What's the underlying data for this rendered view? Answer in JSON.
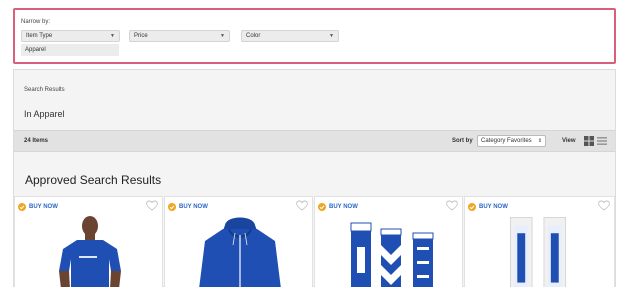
{
  "filters": {
    "narrow_label": "Narrow by:",
    "item_type": "Item Type",
    "price": "Price",
    "color": "Color",
    "selected": "Apparel"
  },
  "results": {
    "search_results_label": "Search Results",
    "in_category": "In Apparel",
    "items_count": "24 Items",
    "sort_by_label": "Sort by",
    "sort_value": "Category Favorites",
    "view_label": "View",
    "approved_title": "Approved Search Results"
  },
  "products": [
    {
      "badge": "BUY NOW",
      "icon": "tshirt-model-image"
    },
    {
      "badge": "BUY NOW",
      "icon": "hoodie-image"
    },
    {
      "badge": "BUY NOW",
      "icon": "socks-image"
    },
    {
      "badge": "BUY NOW",
      "icon": "packaged-socks-image"
    }
  ],
  "colors": {
    "highlight_border": "#d9607a",
    "buy_now": "#2b66c9",
    "badge_icon": "#f0a623",
    "product_blue": "#1f4fb3"
  }
}
